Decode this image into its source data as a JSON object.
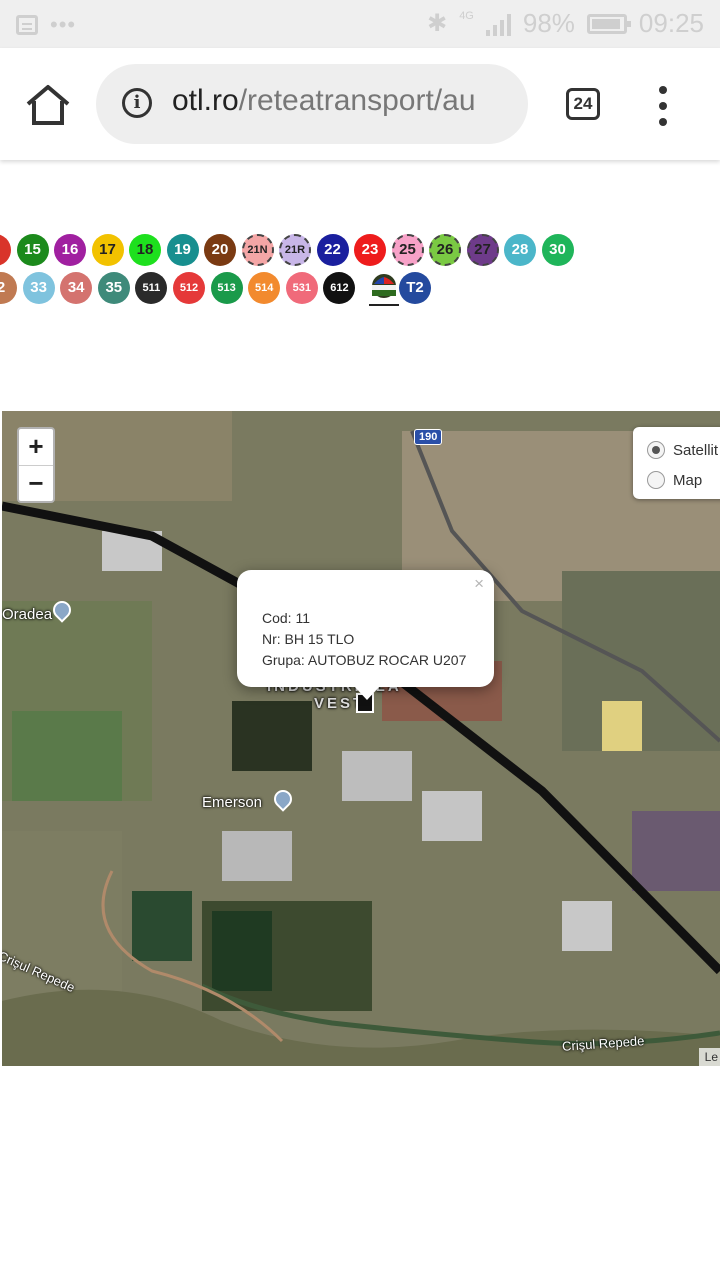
{
  "status_bar": {
    "battery": "98%",
    "time": "09:25",
    "network": "4G",
    "icons": [
      "message-icon",
      "more-dots-icon",
      "bluetooth-icon",
      "signal-icon",
      "battery-icon"
    ]
  },
  "browser": {
    "url_domain": "otl.ro",
    "url_path": "/reteatransport/au",
    "tab_count": "24",
    "icons": [
      "home-icon",
      "info-icon",
      "tabs-icon",
      "menu-icon"
    ]
  },
  "routes": {
    "row1": [
      {
        "label": "",
        "color": "#d9342a"
      },
      {
        "label": "15",
        "color": "#1c8a1c"
      },
      {
        "label": "16",
        "color": "#a020a0"
      },
      {
        "label": "17",
        "color": "#f2c200"
      },
      {
        "label": "18",
        "color": "#1ee01e"
      },
      {
        "label": "19",
        "color": "#178f8f"
      },
      {
        "label": "20",
        "color": "#7a3a12"
      },
      {
        "label": "21N",
        "color": "#f4a6a6"
      },
      {
        "label": "21R",
        "color": "#c8b6e8"
      },
      {
        "label": "22",
        "color": "#1a1f9e"
      },
      {
        "label": "23",
        "color": "#ee1c1c"
      },
      {
        "label": "25",
        "color": "#f7a2c8"
      },
      {
        "label": "26",
        "color": "#7ac943"
      },
      {
        "label": "27",
        "color": "#6e3b8a"
      },
      {
        "label": "28",
        "color": "#4bb6c9"
      },
      {
        "label": "30",
        "color": "#1fb55a"
      }
    ],
    "row2": [
      {
        "label": "2",
        "color": "#c07a52"
      },
      {
        "label": "33",
        "color": "#7fc3de"
      },
      {
        "label": "34",
        "color": "#d4736f"
      },
      {
        "label": "35",
        "color": "#3e8a7a"
      },
      {
        "label": "511",
        "color": "#2a2a2a"
      },
      {
        "label": "512",
        "color": "#e53939"
      },
      {
        "label": "513",
        "color": "#1a9a4a"
      },
      {
        "label": "514",
        "color": "#f28a2e"
      },
      {
        "label": "531",
        "color": "#f06a7a"
      },
      {
        "label": "612",
        "color": "#111111"
      },
      {
        "label": "T2",
        "color": "#244a9e"
      }
    ]
  },
  "map": {
    "zoom_in": "+",
    "zoom_out": "−",
    "layer_options": [
      {
        "label": "Satellit",
        "selected": true
      },
      {
        "label": "Map",
        "selected": false
      }
    ],
    "popup": {
      "close": "×",
      "cod": "Cod: 11",
      "nr": "Nr: BH 15 TLO",
      "grupa": "Grupa: AUTOBUZ ROCAR U207"
    },
    "labels": {
      "oradea": "Oradea",
      "emerson": "Emerson",
      "crisul_left": "Crişul Repede",
      "crisul_right": "Crişul Repede",
      "industrial": "INDUSTRIALA",
      "vest": "VEST",
      "road_190": "190",
      "attribution": "Le"
    }
  }
}
